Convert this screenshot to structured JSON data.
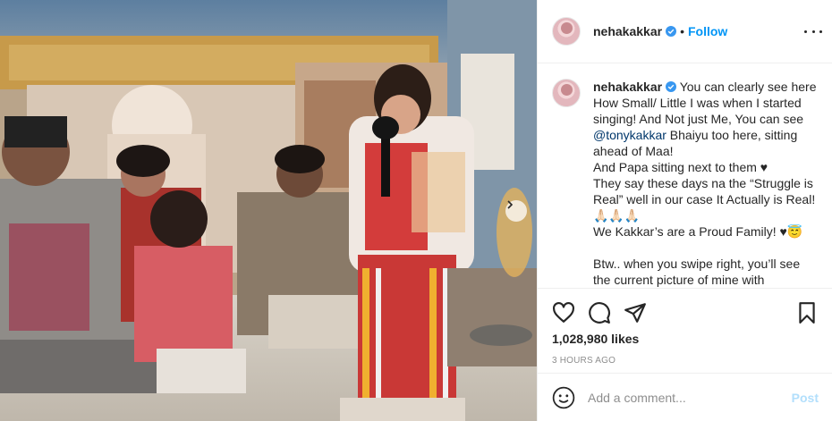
{
  "post": {
    "image_alt": "Vintage family photo of a child singing into a microphone",
    "carousel_next": "next-image"
  },
  "header": {
    "username": "nehakakkar",
    "separator": "•",
    "follow_label": "Follow"
  },
  "caption": {
    "username": "nehakakkar",
    "part1": "You can clearly see here How Small/ Little I was when I started singing! And Not just Me, You can see ",
    "mention": "@tonykakkar",
    "part2": " Bhaiyu too here, sitting ahead of Maa!",
    "line2": "And Papa sitting next to them ♥",
    "line3": "They say these days na the “Struggle is Real” well in our case It Actually is Real! 🙏🏻🙏🏻🙏🏻",
    "line4": "We Kakkar’s are a Proud Family! ♥😇",
    "line5": "Btw.. when you swipe right, you’ll see the current picture of mine with"
  },
  "actions": {
    "like": "heart-icon",
    "comment": "comment-icon",
    "share": "share-icon",
    "save": "bookmark-icon"
  },
  "likes_text": "1,028,980 likes",
  "timestamp": "3 HOURS AGO",
  "comment": {
    "placeholder": "Add a comment...",
    "post_label": "Post"
  },
  "colors": {
    "accent": "#0095f6",
    "mention": "#00376b",
    "post_disabled": "#b2dffc",
    "muted": "#8e8e8e"
  }
}
